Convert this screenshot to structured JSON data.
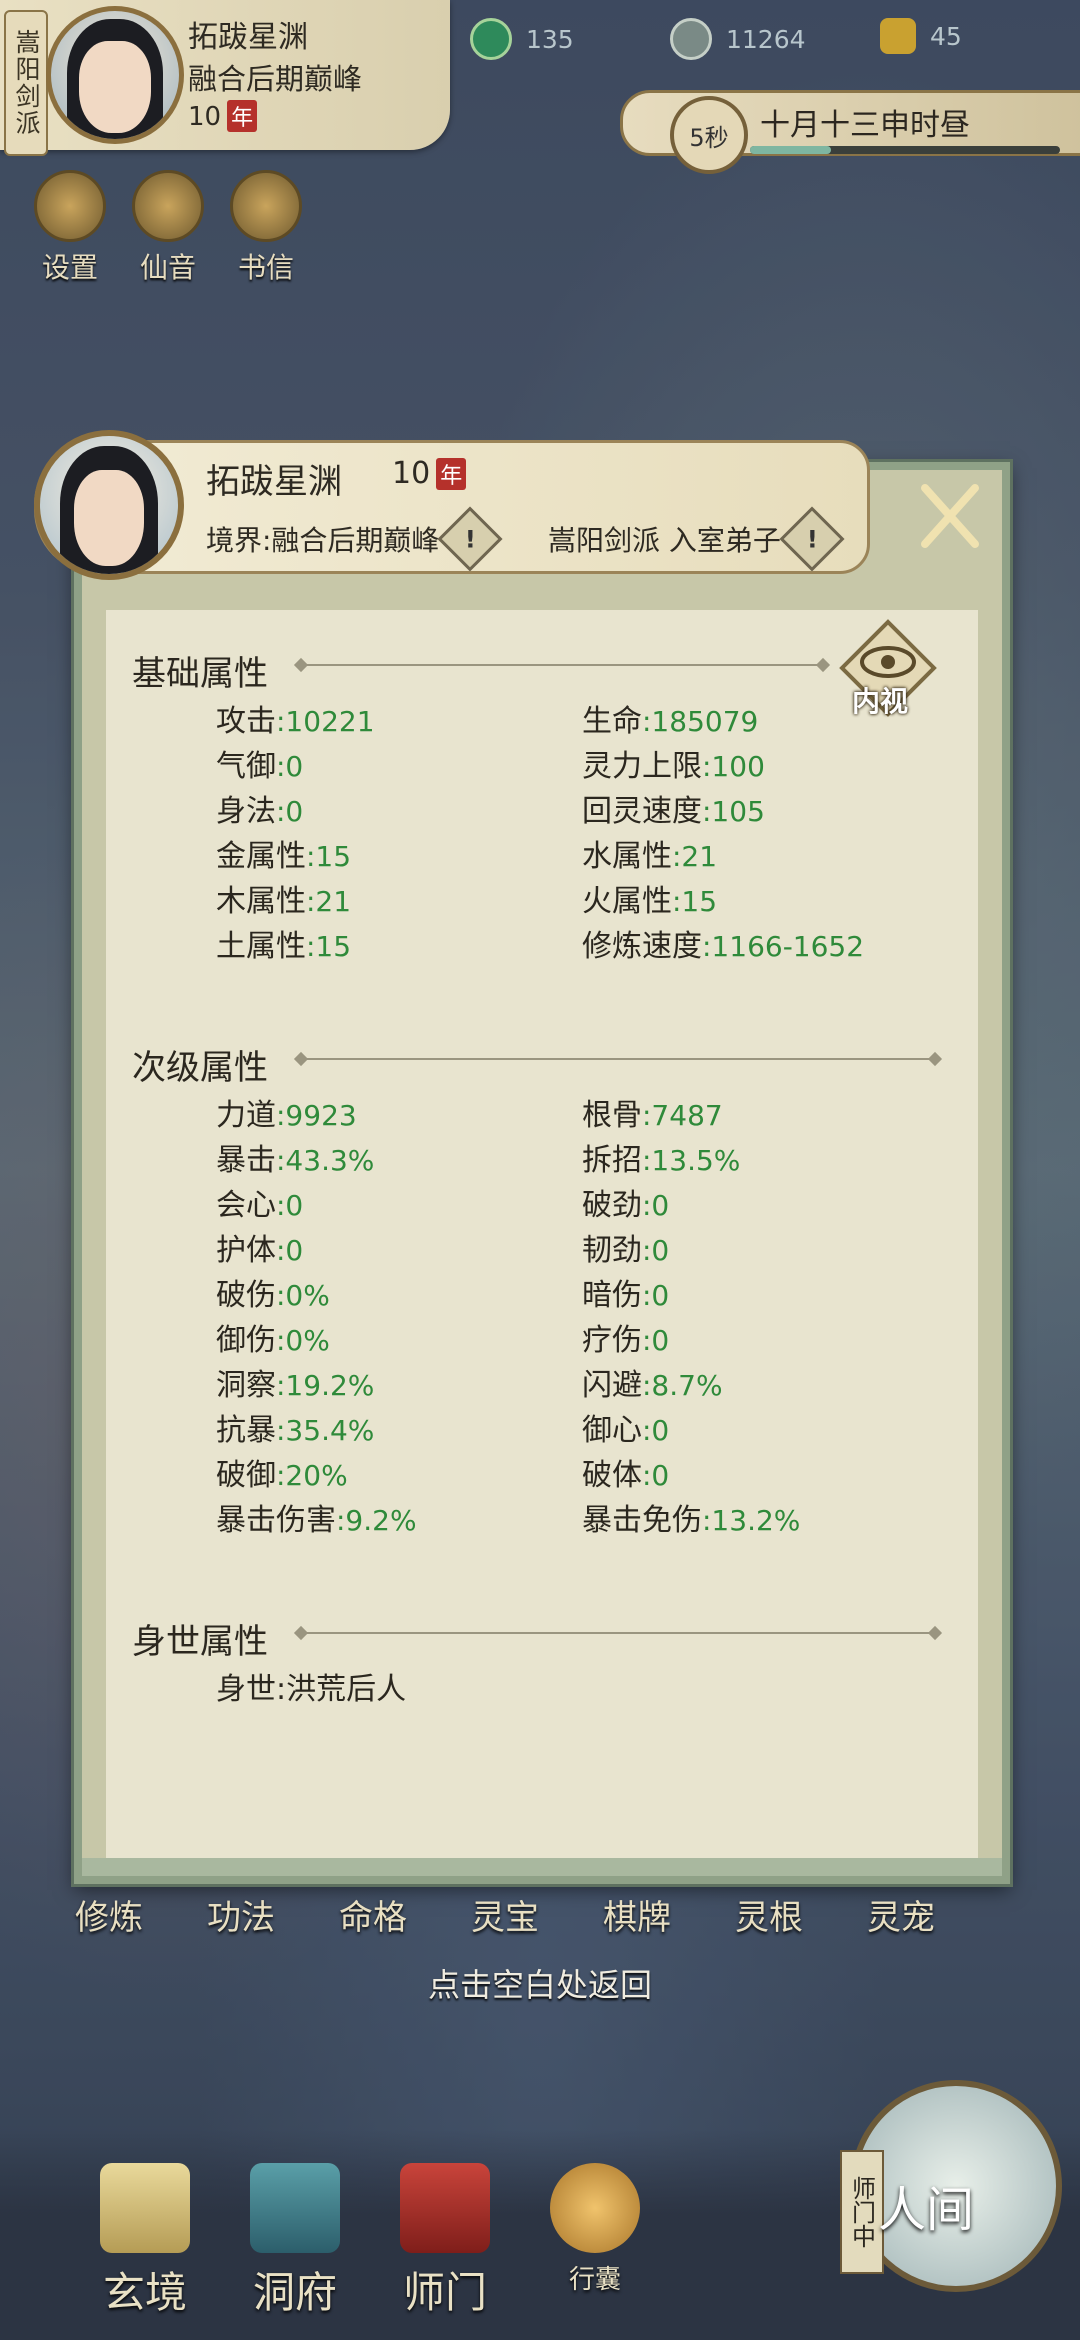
{
  "hud": {
    "sect_short": "嵩阳剑派",
    "name": "拓跋星渊",
    "realm": "融合后期巅峰",
    "age": "10",
    "age_unit": "年",
    "res_1": "135",
    "res_2": "11264",
    "res_3": "45",
    "seconds": "5秒",
    "date": "十月十三申时昼",
    "top_icons": [
      "设置",
      "仙音",
      "书信"
    ]
  },
  "panel": {
    "name": "拓跋星渊",
    "age": "10",
    "age_unit": "年",
    "realm_label": "境界:融合后期巅峰",
    "sect_label": "嵩阳剑派 入室弟子",
    "inner_view": "内视",
    "sections": {
      "basic": {
        "title": "基础属性",
        "left": [
          {
            "k": "攻击",
            "v": ":10221"
          },
          {
            "k": "气御",
            "v": ":0"
          },
          {
            "k": "身法",
            "v": ":0"
          },
          {
            "k": "金属性",
            "v": ":15"
          },
          {
            "k": "木属性",
            "v": ":21"
          },
          {
            "k": "土属性",
            "v": ":15"
          }
        ],
        "right": [
          {
            "k": "生命",
            "v": ":185079"
          },
          {
            "k": "灵力上限",
            "v": ":100"
          },
          {
            "k": "回灵速度",
            "v": ":105"
          },
          {
            "k": "水属性",
            "v": ":21"
          },
          {
            "k": "火属性",
            "v": ":15"
          },
          {
            "k": "修炼速度",
            "v": ":1166-1652"
          }
        ]
      },
      "secondary": {
        "title": "次级属性",
        "left": [
          {
            "k": "力道",
            "v": ":9923"
          },
          {
            "k": "暴击",
            "v": ":43.3%"
          },
          {
            "k": "会心",
            "v": ":0"
          },
          {
            "k": "护体",
            "v": ":0"
          },
          {
            "k": "破伤",
            "v": ":0%"
          },
          {
            "k": "御伤",
            "v": ":0%"
          },
          {
            "k": "洞察",
            "v": ":19.2%"
          },
          {
            "k": "抗暴",
            "v": ":35.4%"
          },
          {
            "k": "破御",
            "v": ":20%"
          },
          {
            "k": "暴击伤害",
            "v": ":9.2%"
          }
        ],
        "right": [
          {
            "k": "根骨",
            "v": ":7487"
          },
          {
            "k": "拆招",
            "v": ":13.5%"
          },
          {
            "k": "破劲",
            "v": ":0"
          },
          {
            "k": "韧劲",
            "v": ":0"
          },
          {
            "k": "暗伤",
            "v": ":0"
          },
          {
            "k": "疗伤",
            "v": ":0"
          },
          {
            "k": "闪避",
            "v": ":8.7%"
          },
          {
            "k": "御心",
            "v": ":0"
          },
          {
            "k": "破体",
            "v": ":0"
          },
          {
            "k": "暴击免伤",
            "v": ":13.2%"
          }
        ]
      },
      "origin": {
        "title": "身世属性",
        "text": "身世:洪荒后人"
      }
    }
  },
  "menu_row": [
    "修炼",
    "功法",
    "命格",
    "灵宝",
    "棋牌",
    "灵根",
    "灵宠"
  ],
  "back_hint": "点击空白处返回",
  "bottom_nav": [
    "玄境",
    "洞府",
    "师门",
    "行囊"
  ],
  "world_button": "人间",
  "shimen_tag": "师门中",
  "colors": {
    "value_green": "#2f8a3a",
    "panel_bg": "#e8e4cf",
    "frame": "#8fa187"
  }
}
